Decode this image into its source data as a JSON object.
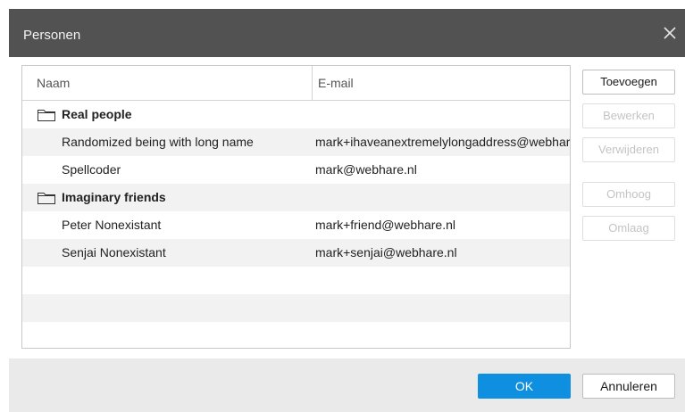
{
  "dialog": {
    "title": "Personen"
  },
  "list": {
    "columns": [
      "Naam",
      "E-mail"
    ],
    "rows": [
      {
        "type": "group",
        "name": "Real people",
        "email": ""
      },
      {
        "type": "item",
        "name": "Randomized being with long name",
        "email": "mark+ihaveanextremelylongaddress@webhare.nl"
      },
      {
        "type": "item",
        "name": "Spellcoder",
        "email": "mark@webhare.nl"
      },
      {
        "type": "group",
        "name": "Imaginary friends",
        "email": ""
      },
      {
        "type": "item",
        "name": "Peter Nonexistant",
        "email": "mark+friend@webhare.nl"
      },
      {
        "type": "item",
        "name": "Senjai Nonexistant",
        "email": "mark+senjai@webhare.nl"
      }
    ]
  },
  "side_buttons": {
    "add": "Toevoegen",
    "edit": "Bewerken",
    "delete": "Verwijderen",
    "up": "Omhoog",
    "down": "Omlaag"
  },
  "footer": {
    "ok": "OK",
    "cancel": "Annuleren"
  },
  "colors": {
    "titlebar": "#525252",
    "primary": "#0f8fe0",
    "footer": "#eaeaea",
    "row_alt": "#f2f2f2"
  },
  "icons": {
    "close": "close-icon",
    "folder": "folder-icon"
  }
}
